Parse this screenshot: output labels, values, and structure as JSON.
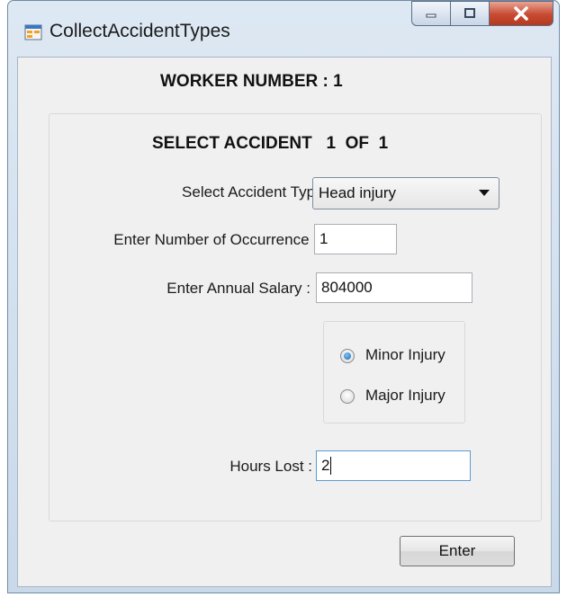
{
  "window": {
    "title": "CollectAccidentTypes",
    "controls": {
      "minimize_icon": "minimize-icon",
      "maximize_icon": "maximize-icon",
      "close_icon": "close-icon"
    }
  },
  "header": {
    "worker_number": "WORKER NUMBER : 1"
  },
  "group": {
    "title": "SELECT ACCIDENT   1  OF  1",
    "accident_type": {
      "label": "Select Accident Type :",
      "value": "Head injury"
    },
    "occurrence": {
      "label": "Enter Number of Occurrence :",
      "value": "1"
    },
    "salary": {
      "label": "Enter Annual Salary :",
      "value": "804000"
    },
    "injury": {
      "options": [
        {
          "label": "Minor Injury",
          "checked": true
        },
        {
          "label": "Major Injury",
          "checked": false
        }
      ]
    },
    "hours_lost": {
      "label": "Hours Lost :",
      "value": "2"
    }
  },
  "actions": {
    "enter_label": "Enter"
  },
  "colors": {
    "selection_accent": "#1767b3",
    "close_button": "#c74a31"
  }
}
